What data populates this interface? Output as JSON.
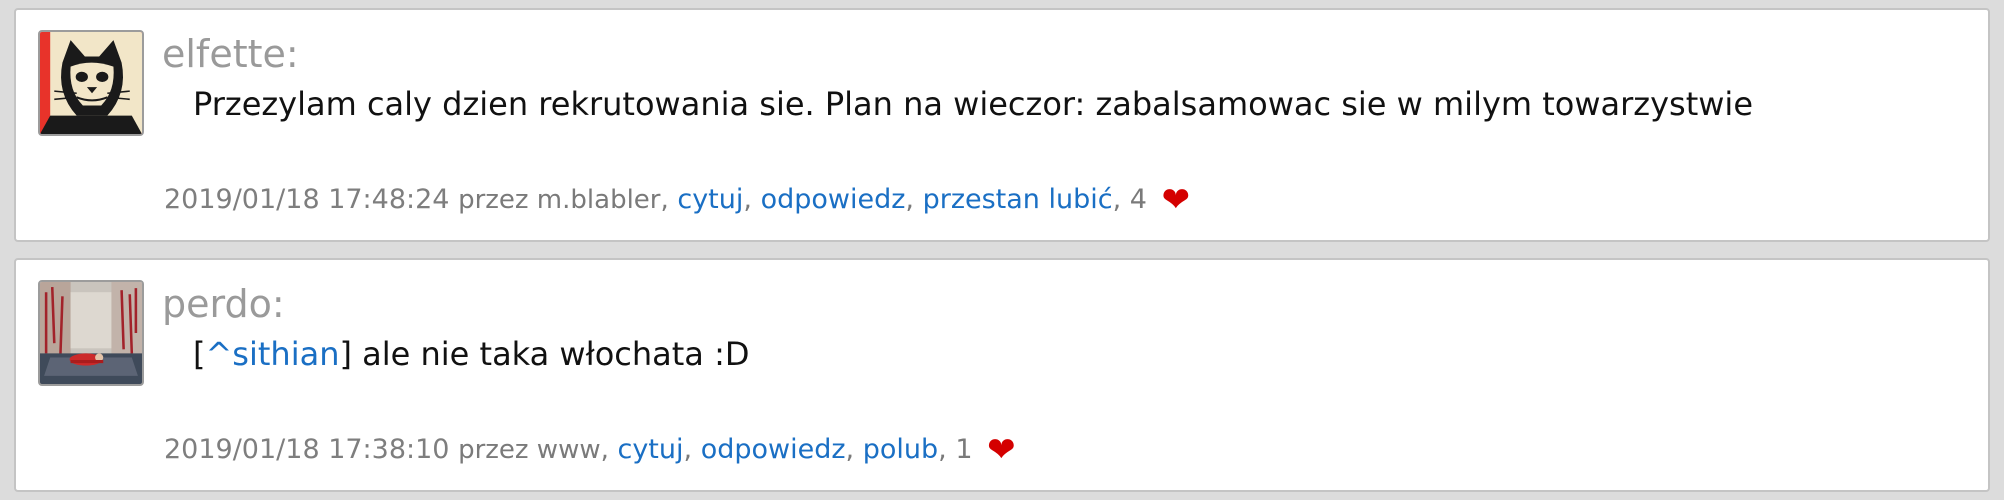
{
  "posts": [
    {
      "author": "elfette:",
      "avatar_icon": "cat-avatar-icon",
      "message": "Przezylam caly dzien rekrutowania sie. Plan na wieczor: zabalsamowac sie w milym towarzystwie",
      "timestamp": "2019/01/18 17:48:24",
      "via": "przez m.blabler,",
      "actions": [
        "cytuj",
        "odpowiedz",
        "przestan lubić"
      ],
      "likes": "4",
      "heart_color": "#d40000"
    },
    {
      "author": "perdo:",
      "avatar_icon": "room-photo-avatar-icon",
      "mention": "^sithian",
      "message_suffix": "] ale nie taka włochata :D",
      "message_prefix": "[",
      "timestamp": "2019/01/18 17:38:10",
      "via": "przez www,",
      "actions": [
        "cytuj",
        "odpowiedz",
        "polub"
      ],
      "likes": "1",
      "heart_color": "#d40000"
    }
  ],
  "colors": {
    "link": "#1a6fc4",
    "muted": "#9a9a9a",
    "background": "#dcdcdc"
  }
}
